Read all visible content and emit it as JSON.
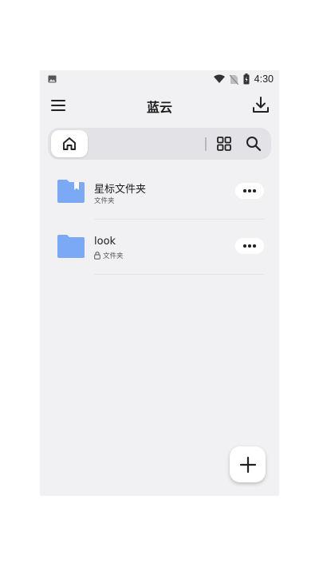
{
  "status_bar": {
    "time": "4:30"
  },
  "app_bar": {
    "title": "蓝云",
    "menu_icon": "menu-icon",
    "download_icon": "download-icon"
  },
  "toolbar": {
    "home_icon": "home-icon",
    "grid_icon": "grid-view-icon",
    "search_icon": "search-icon"
  },
  "files": [
    {
      "name": "星标文件夹",
      "type": "文件夹",
      "locked": false,
      "icon": "bookmark-folder-icon"
    },
    {
      "name": "look",
      "type": "文件夹",
      "locked": true,
      "icon": "folder-icon"
    }
  ],
  "fab": {
    "icon": "plus-icon"
  },
  "colors": {
    "folder": "#7ba9f5",
    "background": "#f1f1f4",
    "toolbar": "#e3e3e7"
  }
}
